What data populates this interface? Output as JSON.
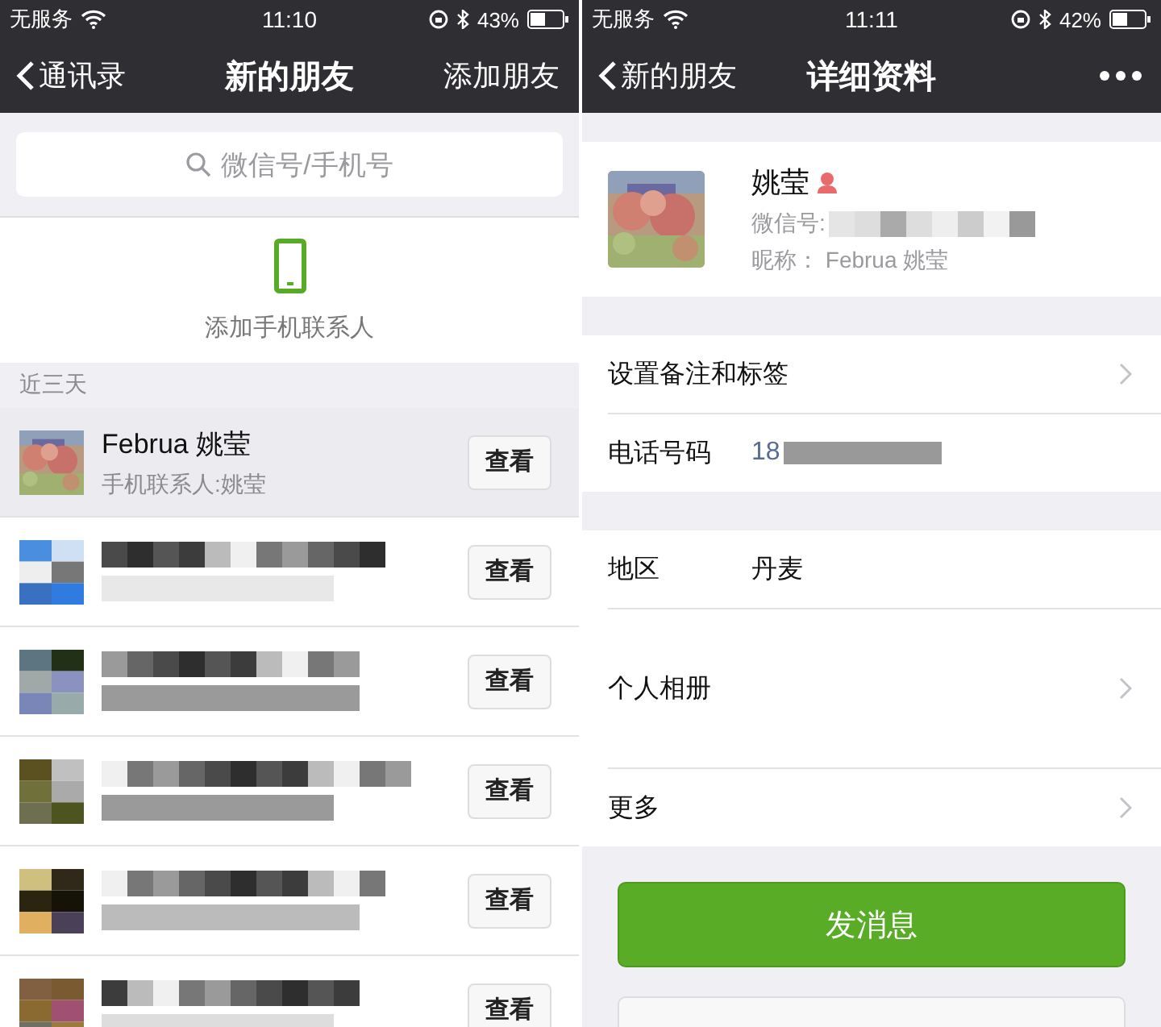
{
  "left": {
    "status_bar": {
      "carrier": "无服务",
      "time": "11:10",
      "battery": "43%"
    },
    "nav": {
      "back": "通讯录",
      "title": "新的朋友",
      "action": "添加朋友"
    },
    "search": {
      "placeholder": "微信号/手机号"
    },
    "add_contacts": {
      "label": "添加手机联系人"
    },
    "section_header": "近三天",
    "friends": [
      {
        "kind": "clear",
        "selected": true,
        "name": "Februa 姚莹",
        "subtitle": "手机联系人:姚莹",
        "button": "查看"
      },
      {
        "kind": "blurred",
        "selected": false,
        "button": "查看"
      },
      {
        "kind": "blurred",
        "selected": false,
        "button": "查看"
      },
      {
        "kind": "blurred",
        "selected": false,
        "button": "查看"
      },
      {
        "kind": "blurred",
        "selected": false,
        "button": "查看"
      },
      {
        "kind": "blurred",
        "selected": false,
        "button": "查看"
      }
    ]
  },
  "right": {
    "status_bar": {
      "carrier": "无服务",
      "time": "11:11",
      "battery": "42%"
    },
    "nav": {
      "back": "新的朋友",
      "title": "详细资料"
    },
    "profile": {
      "name": "姚莹",
      "wechat_id_label": "微信号:",
      "nickname": "昵称：  Februa 姚莹"
    },
    "groups": [
      [
        {
          "kind": "link",
          "label": "设置备注和标签"
        },
        {
          "kind": "phone",
          "label": "电话号码",
          "value": "18"
        }
      ],
      [
        {
          "kind": "value",
          "label": "地区",
          "value": "丹麦"
        },
        {
          "kind": "album",
          "label": "个人相册"
        },
        {
          "kind": "link",
          "label": "更多"
        }
      ]
    ],
    "buttons": [
      {
        "kind": "primary",
        "label": "发消息"
      },
      {
        "kind": "secondary"
      }
    ]
  }
}
